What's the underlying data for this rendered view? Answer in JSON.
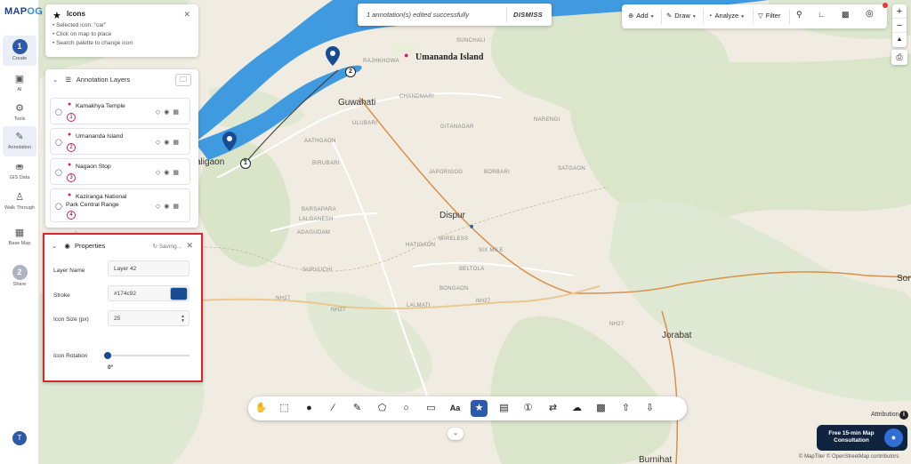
{
  "app": {
    "logo_main": "MAP",
    "logo_accent": "OG"
  },
  "sidebar": {
    "items": [
      {
        "label": "Create",
        "step": "1"
      },
      {
        "label": "AI"
      },
      {
        "label": "Tools"
      },
      {
        "label": "Annotation"
      },
      {
        "label": "GIS Data"
      },
      {
        "label": "Walk Through"
      },
      {
        "label": "Base Map"
      },
      {
        "label": "Share",
        "step": "2"
      }
    ],
    "user_initial": "T"
  },
  "icons_panel": {
    "title": "Icons",
    "hints": [
      "• Selected icon: \"car\"",
      "• Click on map to place",
      "• Search palette to change icon"
    ]
  },
  "layers_panel": {
    "title": "Annotation Layers",
    "layers": [
      {
        "name": "Kamakhya Temple",
        "num": "1"
      },
      {
        "name": "Umananda Island",
        "num": "2"
      },
      {
        "name": "Nagaon Stop",
        "num": "3"
      },
      {
        "name_line1": "Kaziranga National",
        "name_line2": "Park Central Range",
        "num": "4"
      }
    ]
  },
  "properties": {
    "title": "Properties",
    "status": "Saving...",
    "layer_name_label": "Layer Name",
    "layer_name_value": "Layer 42",
    "stroke_label": "Stroke",
    "stroke_value": "#174c92",
    "icon_size_label": "Icon Size (px)",
    "icon_size_value": "25",
    "icon_rotation_label": "Icon Rotation",
    "icon_rotation_value": "0°"
  },
  "toast": {
    "message": "1 annotation(s) edited successfully",
    "action": "DISMISS"
  },
  "toolbar": {
    "add": "Add",
    "draw": "Draw",
    "analyze": "Analyze",
    "filter": "Filter"
  },
  "map": {
    "places": {
      "guwahati": "Guwahati",
      "dispur": "Dispur",
      "umananda": "Umananda Island",
      "maligaon": "aligaon",
      "jorabat": "Jorabat",
      "sonapur": "Son",
      "burnihat": "Burnihat",
      "sunchali": "SUNCHALI",
      "rajhkhowa": "RAJHKHOWA",
      "chandmari": "CHANDMARI",
      "ulubari": "ULUBARI",
      "narengi": "NARENGI",
      "gitanagar": "GITANAGAR",
      "aathgaon": "AATHGAON",
      "birubari": "BIRUBARI",
      "japorigog": "JAPORIGOG",
      "borbari": "BORBARI",
      "satgaon": "SATGAON",
      "barsapara": "BARSAPARA",
      "laganesh": "LALGANESH",
      "adagudam": "ADAGUDAM",
      "hatigaon": "HATIGAON",
      "wireless": "WIRELESS",
      "sixmile": "SIX MILE",
      "beltola": "BELTOLA",
      "survuchi": "SURVUCHI",
      "bongaon": "BONGAON",
      "lalmati": "LALMATI",
      "nh27a": "NH27",
      "nh27b": "NH27",
      "nh27c": "NH27",
      "nh27d": "NH27"
    }
  },
  "attribution": {
    "label": "Attribution",
    "consult": "Free 15-min Map Consultation",
    "copyright": "© MapTiler © OpenStreetMap contributors"
  },
  "colors": {
    "accent": "#2d5aa8",
    "stroke": "#174c92",
    "highlight_border": "#d9262b",
    "water": "#3f9ae0",
    "marker_pin": "#d81b60"
  }
}
